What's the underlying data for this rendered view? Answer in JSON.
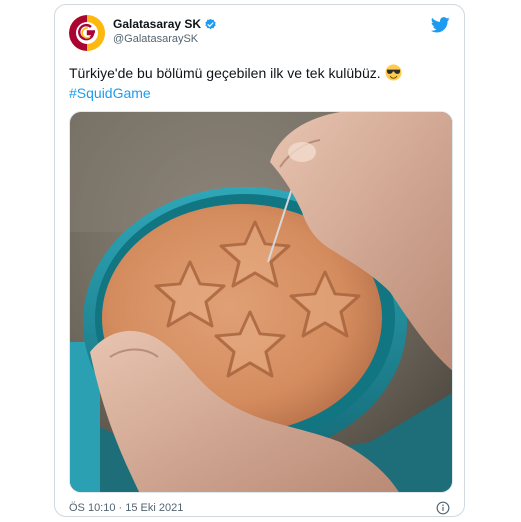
{
  "tweet": {
    "display_name": "Galatasaray SK",
    "handle": "@GalatasaraySK",
    "text": "Türkiye'de bu bölümü geçebilen ilk ve tek kulübüz.",
    "hashtag": "#SquidGame",
    "emoji_icon": "sunglasses-emoji",
    "timestamp": "ÖS 10:10 · 15 Eki 2021"
  },
  "icons": {
    "brand": "twitter-bird-icon",
    "verified": "verified-badge-icon",
    "info": "info-icon"
  },
  "colors": {
    "accent": "#1d9bf0",
    "text": "#0f1419",
    "muted": "#536471",
    "border": "#cfd9de",
    "club_yellow": "#fdb912",
    "club_red": "#a90432"
  }
}
